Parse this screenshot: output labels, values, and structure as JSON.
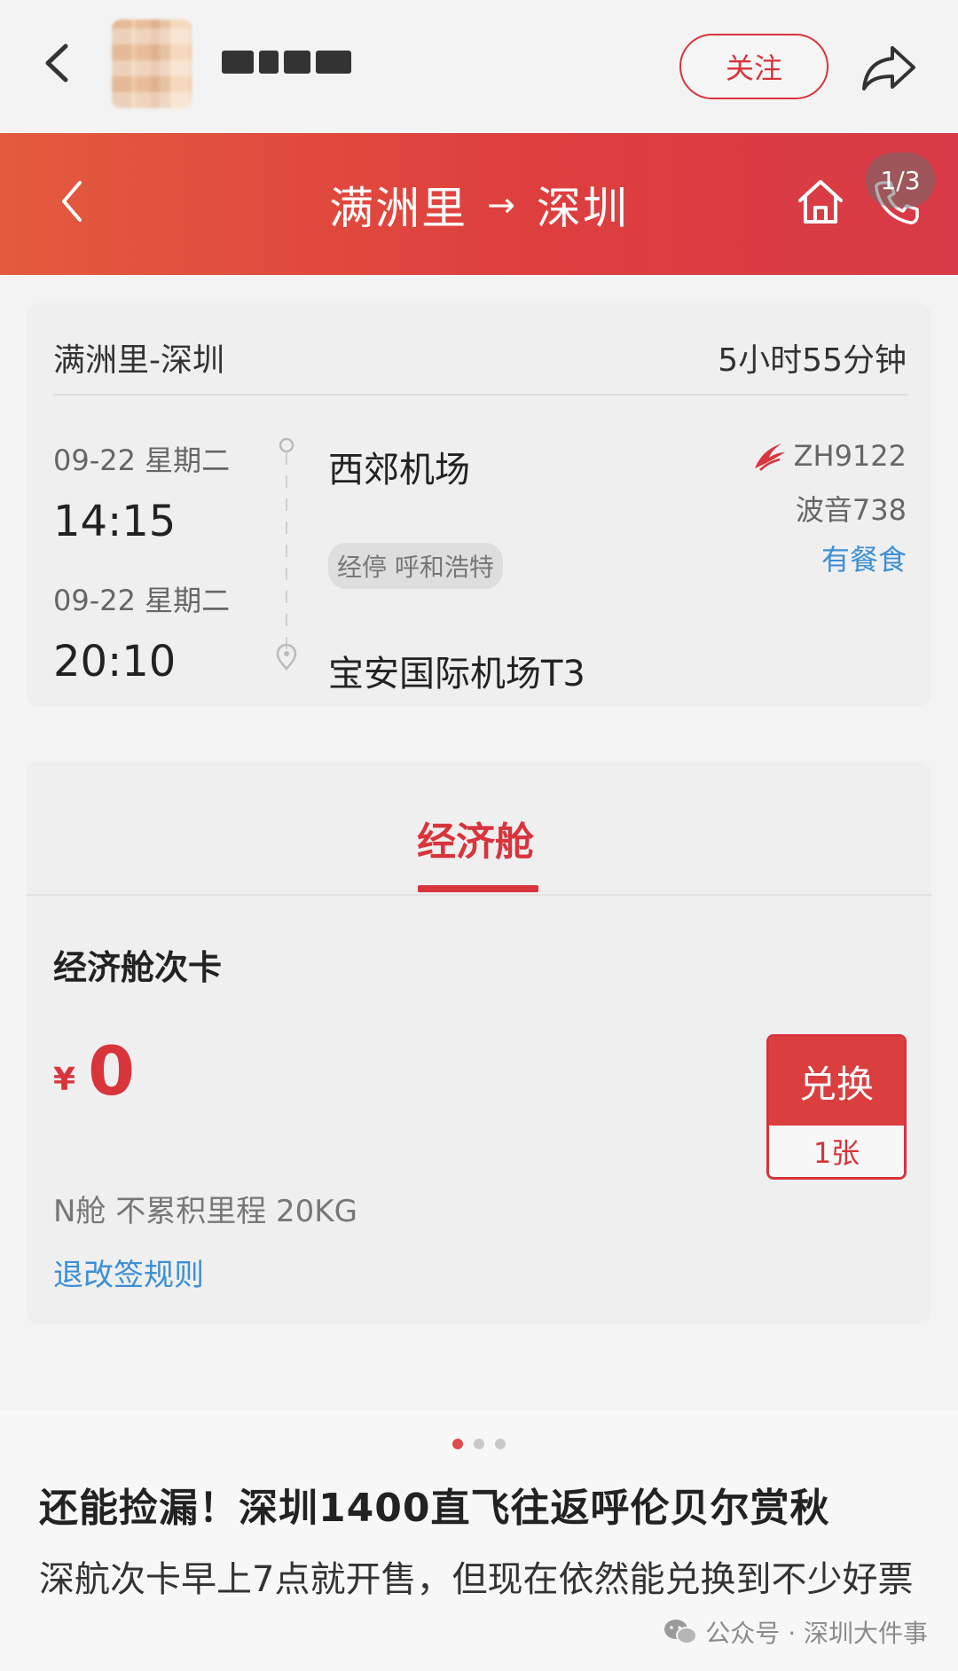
{
  "social_bar": {
    "follow_label": "关注"
  },
  "header": {
    "origin": "满洲里",
    "arrow": "→",
    "destination": "深圳",
    "image_counter": "1/3"
  },
  "flight": {
    "route": "满洲里-深圳",
    "duration": "5小时55分钟",
    "departure": {
      "date": "09-22 星期二",
      "time": "14:15",
      "airport": "西郊机场"
    },
    "stopover": "经停 呼和浩特",
    "arrival": {
      "date": "09-22 星期二",
      "time": "20:10",
      "airport": "宝安国际机场T3"
    },
    "flight_number": "ZH9122",
    "aircraft": "波音738",
    "meal": "有餐食"
  },
  "cabin": {
    "tab_label": "经济舱",
    "product_name": "经济舱次卡",
    "currency_symbol": "¥",
    "price": "0",
    "exchange_label": "兑换",
    "exchange_count": "1张",
    "info": "N舱 不累积里程 20KG",
    "rules_link": "退改签规则"
  },
  "article": {
    "title": "还能捡漏！深圳1400直飞往返呼伦贝尔赏秋",
    "body": "深航次卡早上7点就开售，但现在依然能兑换到不少好票",
    "watermark": "公众号 · 深圳大件事"
  },
  "colors": {
    "brand_red": "#d8343c",
    "link_blue": "#3c8fd6"
  },
  "icons": [
    "back-icon",
    "share-icon",
    "home-icon",
    "phone-icon",
    "airline-logo-icon",
    "wechat-icon"
  ]
}
